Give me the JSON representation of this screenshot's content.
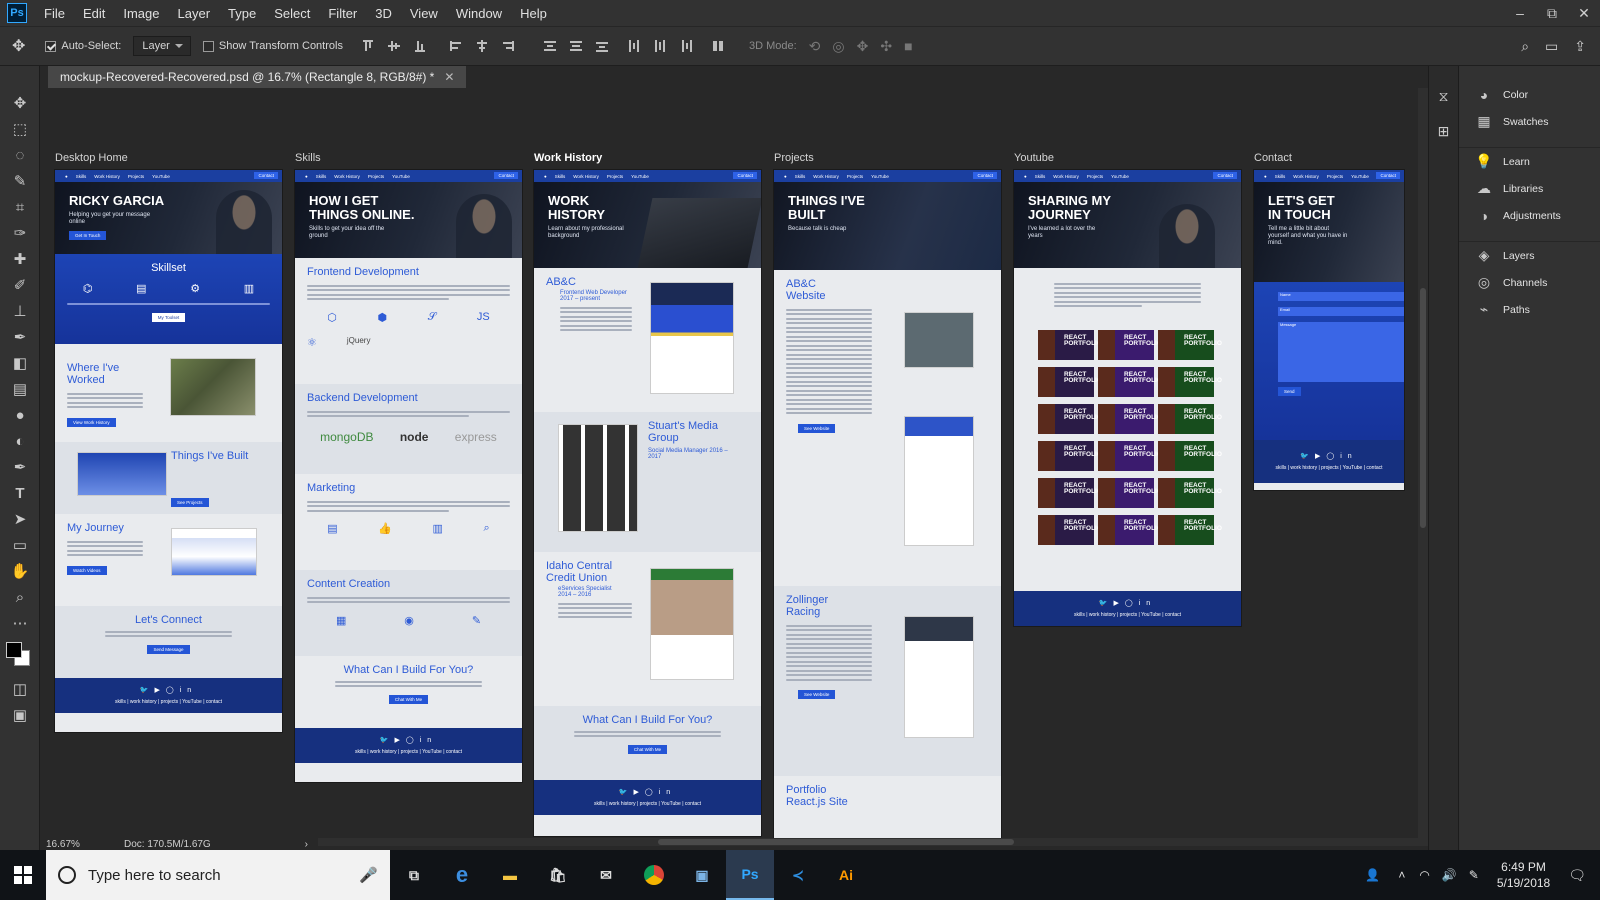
{
  "app": {
    "logo": "Ps"
  },
  "menu": [
    "File",
    "Edit",
    "Image",
    "Layer",
    "Type",
    "Select",
    "Filter",
    "3D",
    "View",
    "Window",
    "Help"
  ],
  "window_controls": [
    "–",
    "⧉",
    "✕"
  ],
  "options": {
    "auto_select_label": "Auto-Select:",
    "auto_select_checked": true,
    "layer_dropdown": "Layer",
    "show_transform_label": "Show Transform Controls",
    "mode_3d": "3D Mode:"
  },
  "tools": [
    "move-icon",
    "marquee-icon",
    "lasso-icon",
    "quick-select-icon",
    "crop-icon",
    "eyedropper-icon",
    "healing-icon",
    "brush-icon",
    "stamp-icon",
    "history-brush-icon",
    "eraser-icon",
    "gradient-icon",
    "blur-icon",
    "dodge-icon",
    "pen-icon",
    "type-icon",
    "path-select-icon",
    "rectangle-icon",
    "hand-icon",
    "zoom-icon",
    "more-icon"
  ],
  "document": {
    "tab_title": "mockup-Recovered-Recovered.psd @ 16.7% (Rectangle 8, RGB/8#) *",
    "close": "✕"
  },
  "status": {
    "zoom": "16.67%",
    "doc": "Doc: 170.5M/1.67G",
    "arrow": "›"
  },
  "artboards": {
    "home": {
      "label": "Desktop Home",
      "hero_title": "RICKY GARCIA",
      "hero_sub": "Helping you get your message online",
      "cta": "Get In Touch",
      "skillset": "Skillset",
      "skills_btn": "My Toolset",
      "where": "Where I've Worked",
      "where_btn": "View Work History",
      "things": "Things I've Built",
      "things_btn": "See Projects",
      "journey": "My Journey",
      "journey_btn": "Watch Videos",
      "connect": "Let's Connect",
      "connect_btn": "Send Message"
    },
    "skills": {
      "label": "Skills",
      "hero_title": "HOW I GET THINGS ONLINE.",
      "hero_sub": "Skills to get your idea off the ground",
      "frontend": "Frontend Development",
      "backend": "Backend Development",
      "mongo": "mongoDB",
      "node": "node",
      "express": "express",
      "marketing": "Marketing",
      "content": "Content Creation",
      "build": "What Can I Build For You?",
      "build_btn": "Chat With Me"
    },
    "work": {
      "label": "Work History",
      "hero_title": "WORK HISTORY",
      "hero_sub": "Learn about my professional background",
      "job1": "AB&C",
      "job1_sub": "Frontend Web Developer 2017 – present",
      "job2": "Stuart's Media Group",
      "job2_sub": "Social Media Manager 2016 – 2017",
      "job3": "Idaho Central Credit Union",
      "job3_sub": "eServices Specialist 2014 – 2016",
      "build": "What Can I Build For You?",
      "build_btn": "Chat With Me"
    },
    "projects": {
      "label": "Projects",
      "hero_title": "THINGS I'VE BUILT",
      "hero_sub": "Because talk is cheap",
      "p1": "AB&C Website",
      "p1_btn": "See Website",
      "p2": "Zollinger Racing",
      "p2_btn": "See Website",
      "p3": "Portfolio React.js Site"
    },
    "youtube": {
      "label": "Youtube",
      "hero_title": "SHARING MY JOURNEY",
      "hero_sub": "I've learned a lot over the years",
      "tile_text": "REACT PORTFOLIO"
    },
    "contact": {
      "label": "Contact",
      "hero_title": "LET'S GET IN TOUCH",
      "hero_sub": "Tell me a little bit about yourself and what you have in mind.",
      "name_ph": "Name",
      "email_ph": "Email",
      "msg_ph": "Message",
      "send": "Send"
    }
  },
  "nav": {
    "items": [
      "Skills",
      "Work History",
      "Projects",
      "YouTube"
    ],
    "contact": "Contact"
  },
  "footer_links": "skills | work history | projects | YouTube | contact",
  "right_panels": [
    "Color",
    "Swatches",
    "Learn",
    "Libraries",
    "Adjustments",
    "Layers",
    "Channels",
    "Paths"
  ],
  "taskbar": {
    "search_placeholder": "Type here to search",
    "time": "6:49 PM",
    "date": "5/19/2018"
  },
  "colors": {
    "site_blue": "#1b3fa0",
    "ps_bg": "#323232",
    "canvas_bg": "#282828"
  }
}
